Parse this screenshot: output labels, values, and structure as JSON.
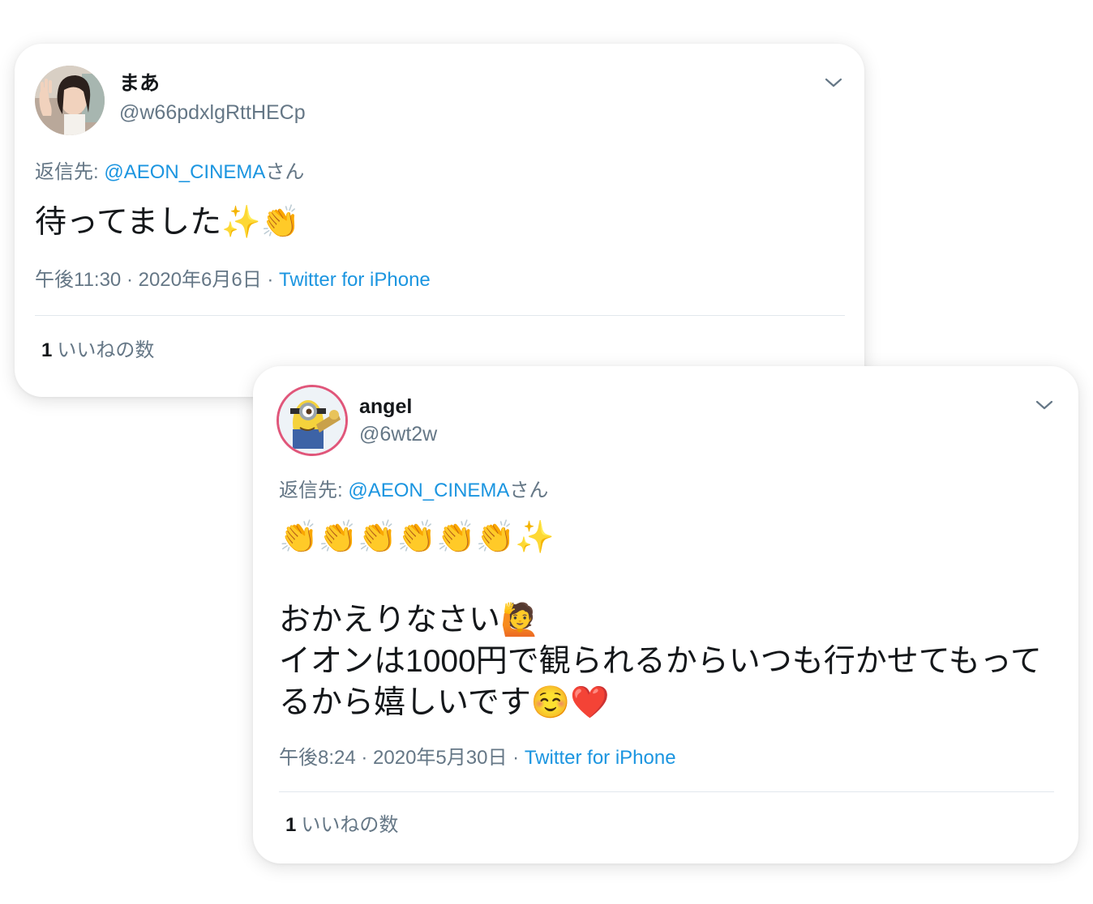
{
  "tweets": [
    {
      "display_name": "まあ",
      "handle": "@w66pdxlgRttHECp",
      "reply_prefix": "返信先: ",
      "reply_mention": "@AEON_CINEMA",
      "reply_suffix": "さん",
      "text": "待ってました✨👏",
      "timestamp": "午後11:30 · 2020年6月6日 · ",
      "source": "Twitter for iPhone",
      "like_count": "1",
      "like_label": "いいねの数",
      "colors": {
        "mention": "#1b95e0",
        "secondary": "#657786",
        "primary": "#14171a"
      }
    },
    {
      "display_name": "angel",
      "handle": "@6wt2w",
      "reply_prefix": "返信先: ",
      "reply_mention": "@AEON_CINEMA",
      "reply_suffix": "さん",
      "text": "👏👏👏👏👏👏✨\n\nおかえりなさい🙋\nイオンは1000円で観られるからいつも行かせてもって\nるから嬉しいです☺️❤️",
      "timestamp": "午後8:24 · 2020年5月30日 · ",
      "source": "Twitter for iPhone",
      "like_count": "1",
      "like_label": "いいねの数",
      "colors": {
        "avatar_ring": "#e0567a"
      }
    }
  ],
  "icons": {
    "menu": "chevron-down-icon",
    "avatar_1": "avatar-photo-woman-waving",
    "avatar_2": "avatar-minion-character"
  }
}
